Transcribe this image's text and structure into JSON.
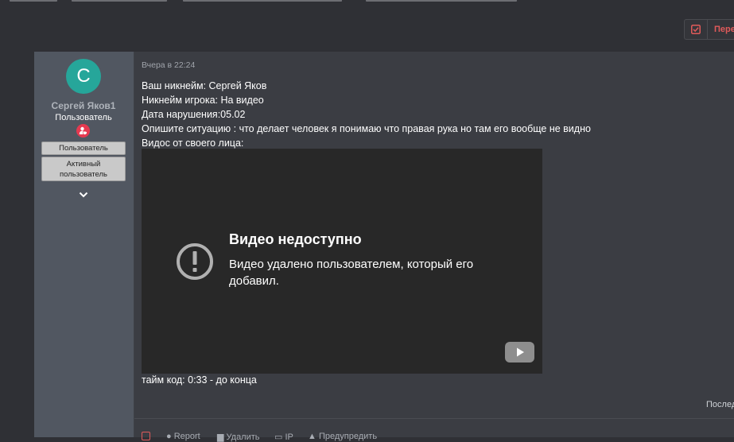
{
  "header": {
    "moderation_label": "Перен",
    "moderation_icon": "checkbox-checked-icon"
  },
  "post": {
    "author": {
      "avatar_letter": "С",
      "avatar_color": "#26a69a",
      "name": "Сергей Яков1",
      "title": "Пользователь",
      "role_icon": "user-shield-icon",
      "banners": [
        "Пользователь",
        "Активный пользователь"
      ],
      "expand_icon": "chevron-down-icon"
    },
    "date": "Вчера в 22:24",
    "lines": [
      "Ваш никнейм: Сергей Яков",
      "Никнейм игрока: На видео",
      "Дата нарушения:05.02",
      "Опишите ситуацию : что делает человек я понимаю что правая рука но там его вообще не видно",
      "Видос от своего лица:"
    ],
    "video": {
      "title": "Видео недоступно",
      "message": "Видео удалено пользователем, который его добавил.",
      "warning_icon": "alert-circle-icon",
      "play_icon": "youtube-play-icon"
    },
    "timecode": "тайм код: 0:33 - до конца",
    "last_edit": "Послед",
    "actions": {
      "report": "Report",
      "delete": "Удалить",
      "ip": "IP",
      "warn": "Предупредить"
    }
  },
  "colors": {
    "accent_red": "#e05a5a",
    "role_badge": "#e53950",
    "sidebar": "#515761",
    "content": "#3b3d43"
  }
}
